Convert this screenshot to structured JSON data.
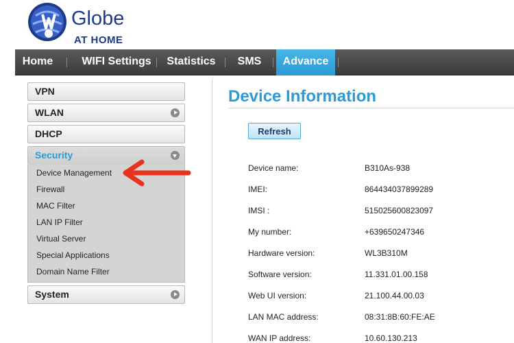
{
  "brand": {
    "name": "Globe",
    "subtitle": "AT HOME",
    "color": "#1c3a8a"
  },
  "nav": {
    "items": [
      {
        "label": "Home"
      },
      {
        "label": "WIFI Settings"
      },
      {
        "label": "Statistics"
      },
      {
        "label": "SMS"
      },
      {
        "label": "Advance",
        "active": true
      }
    ],
    "active_color": "#2a9bd6"
  },
  "sidebar": {
    "items": [
      {
        "label": "VPN"
      },
      {
        "label": "WLAN",
        "icon": "chevron-right-icon"
      },
      {
        "label": "DHCP"
      },
      {
        "label": "Security",
        "icon": "chevron-down-icon",
        "expanded": true
      },
      {
        "label": "System",
        "icon": "chevron-right-icon"
      }
    ],
    "security_submenu": [
      "Device Management",
      "Firewall",
      "MAC Filter",
      "LAN IP Filter",
      "Virtual Server",
      "Special Applications",
      "Domain Name Filter"
    ]
  },
  "annotation": {
    "icon": "red-arrow-icon",
    "color": "#e8321e"
  },
  "main": {
    "title": "Device Information",
    "refresh_label": "Refresh",
    "rows": [
      {
        "label": "Device name:",
        "value": "B310As-938"
      },
      {
        "label": "IMEI:",
        "value": "864434037899289"
      },
      {
        "label": "IMSI :",
        "value": "515025600823097"
      },
      {
        "label": "My number:",
        "value": "+639650247346"
      },
      {
        "label": "Hardware version:",
        "value": "WL3B310M"
      },
      {
        "label": "Software version:",
        "value": "11.331.01.00.158"
      },
      {
        "label": "Web UI version:",
        "value": "21.100.44.00.03"
      },
      {
        "label": "LAN MAC address:",
        "value": "08:31:8B:60:FE:AE"
      },
      {
        "label": "WAN IP address:",
        "value": "10.60.130.213"
      }
    ]
  }
}
